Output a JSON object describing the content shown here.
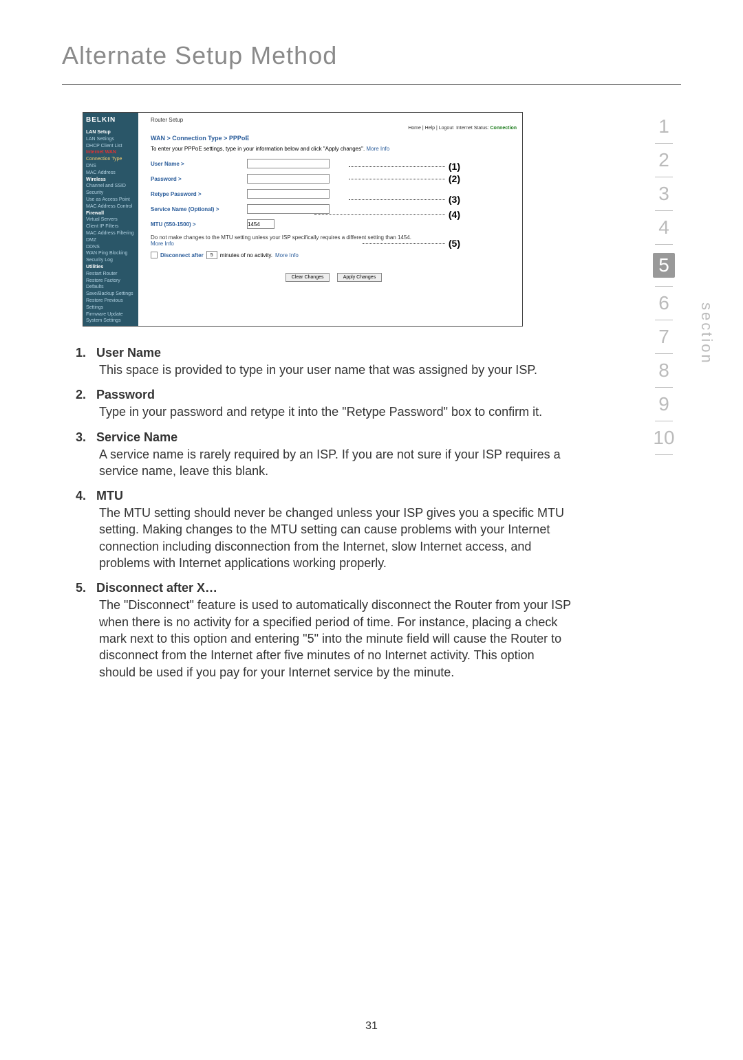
{
  "page": {
    "title": "Alternate Setup Method",
    "page_number": "31",
    "section_label": "section"
  },
  "section_nav": {
    "items": [
      "1",
      "2",
      "3",
      "4",
      "5",
      "6",
      "7",
      "8",
      "9",
      "10"
    ],
    "active": "5"
  },
  "screenshot": {
    "logo": "BELKIN",
    "topbar_title": "Router Setup",
    "toplinks": {
      "home": "Home",
      "help": "Help",
      "logout": "Logout",
      "status_label": "Internet Status:",
      "status_value": "Connection"
    },
    "breadcrumb": "WAN > Connection Type > PPPoE",
    "instruction": "To enter your PPPoE settings, type in your information below and click \"Apply changes\".",
    "more_info": "More Info",
    "sidebar": {
      "groups": [
        {
          "header": "LAN Setup",
          "items": [
            "LAN Settings",
            "DHCP Client List"
          ]
        },
        {
          "header": "Internet WAN",
          "items": [
            "Connection Type",
            "DNS",
            "MAC Address"
          ],
          "header_red": true,
          "active_item": "Connection Type"
        },
        {
          "header": "Wireless",
          "items": [
            "Channel and SSID",
            "Security",
            "Use as Access Point",
            "MAC Address Control"
          ]
        },
        {
          "header": "Firewall",
          "items": [
            "Virtual Servers",
            "Client IP Filters",
            "MAC Address Filtering",
            "DMZ",
            "DDNS",
            "WAN Ping Blocking",
            "Security Log"
          ]
        },
        {
          "header": "Utilities",
          "items": [
            "Restart Router",
            "Restore Factory Defaults",
            "Save/Backup Settings",
            "Restore Previous Settings",
            "Firmware Update",
            "System Settings"
          ]
        }
      ]
    },
    "fields": {
      "user_name": "User Name >",
      "password": "Password >",
      "retype_password": "Retype Password >",
      "service_name": "Service Name (Optional) >",
      "mtu": "MTU (550-1500) >",
      "mtu_value": "1454"
    },
    "mtu_note": "Do not make changes to the MTU setting unless your ISP specifically requires a different setting than 1454.",
    "disconnect": {
      "label": "Disconnect after",
      "value": "5",
      "suffix": "minutes of no activity.",
      "more_info": "More Info"
    },
    "buttons": {
      "clear": "Clear Changes",
      "apply": "Apply Changes"
    },
    "callouts": {
      "c1": "(1)",
      "c2": "(2)",
      "c3": "(3)",
      "c4": "(4)",
      "c5": "(5)"
    }
  },
  "definitions": [
    {
      "num": "1.",
      "head": "User Name",
      "body": "This space is provided to type in your user name that was assigned by your ISP."
    },
    {
      "num": "2.",
      "head": "Password",
      "body": "Type in your password and retype it into the \"Retype Password\" box to confirm it."
    },
    {
      "num": "3.",
      "head": "Service Name",
      "body": "A service name is rarely required by an ISP. If you are not sure if your ISP requires a service name, leave this blank."
    },
    {
      "num": "4.",
      "head": "MTU",
      "body": "The MTU setting should never be changed unless your ISP gives you a specific MTU setting. Making changes to the MTU setting can cause problems with your Internet connection including disconnection from the Internet, slow Internet access, and problems with Internet applications working properly."
    },
    {
      "num": "5.",
      "head": "Disconnect after X…",
      "body": "The \"Disconnect\" feature is used to automatically disconnect the Router from your ISP when there is no activity for a specified period of time. For instance, placing a check mark next to this option and entering \"5\" into the minute field will cause the Router to disconnect from the Internet after five minutes of no Internet activity. This option should be used if you pay for your Internet service by the minute."
    }
  ]
}
